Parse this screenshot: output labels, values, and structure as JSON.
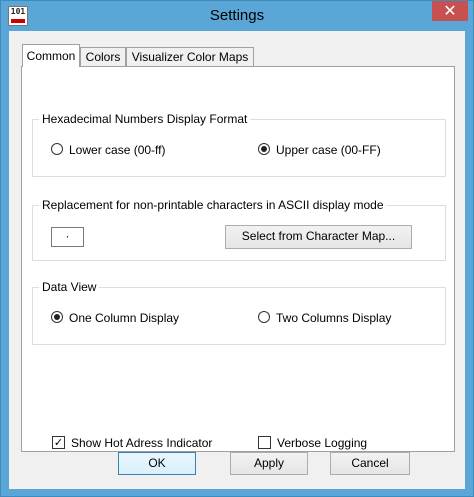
{
  "window": {
    "title": "Settings",
    "close_glyph": "✕",
    "app_icon_text": "101"
  },
  "tabs": [
    {
      "label": "Common",
      "active": true
    },
    {
      "label": "Colors",
      "active": false
    },
    {
      "label": "Visualizer Color Maps",
      "active": false
    }
  ],
  "hex_group": {
    "legend": "Hexadecimal Numbers Display Format",
    "options": [
      {
        "label": "Lower case (00-ff)",
        "selected": false
      },
      {
        "label": "Upper case (00-FF)",
        "selected": true
      }
    ]
  },
  "replacement_group": {
    "legend": "Replacement for non-printable characters in ASCII display mode",
    "char_value": "·",
    "select_button_label": "Select from Character Map..."
  },
  "dataview_group": {
    "legend": "Data View",
    "options": [
      {
        "label": "One Column Display",
        "selected": true
      },
      {
        "label": "Two Columns Display",
        "selected": false
      }
    ]
  },
  "checkboxes": [
    {
      "label": "Show Hot Adress Indicator",
      "checked": true,
      "mark": "✓"
    },
    {
      "label": "Verbose Logging",
      "checked": false,
      "mark": ""
    }
  ],
  "buttons": {
    "ok_label": "OK",
    "apply_label": "Apply",
    "cancel_label": "Cancel"
  },
  "colors": {
    "title_bar": "#5aa6d6",
    "close_button": "#c75050",
    "dialog_bg": "#f0f0f0"
  },
  "icons": {
    "close": "close-icon",
    "radio_selected": "radio-dot-icon",
    "checkbox_checked": "check-mark-icon"
  }
}
